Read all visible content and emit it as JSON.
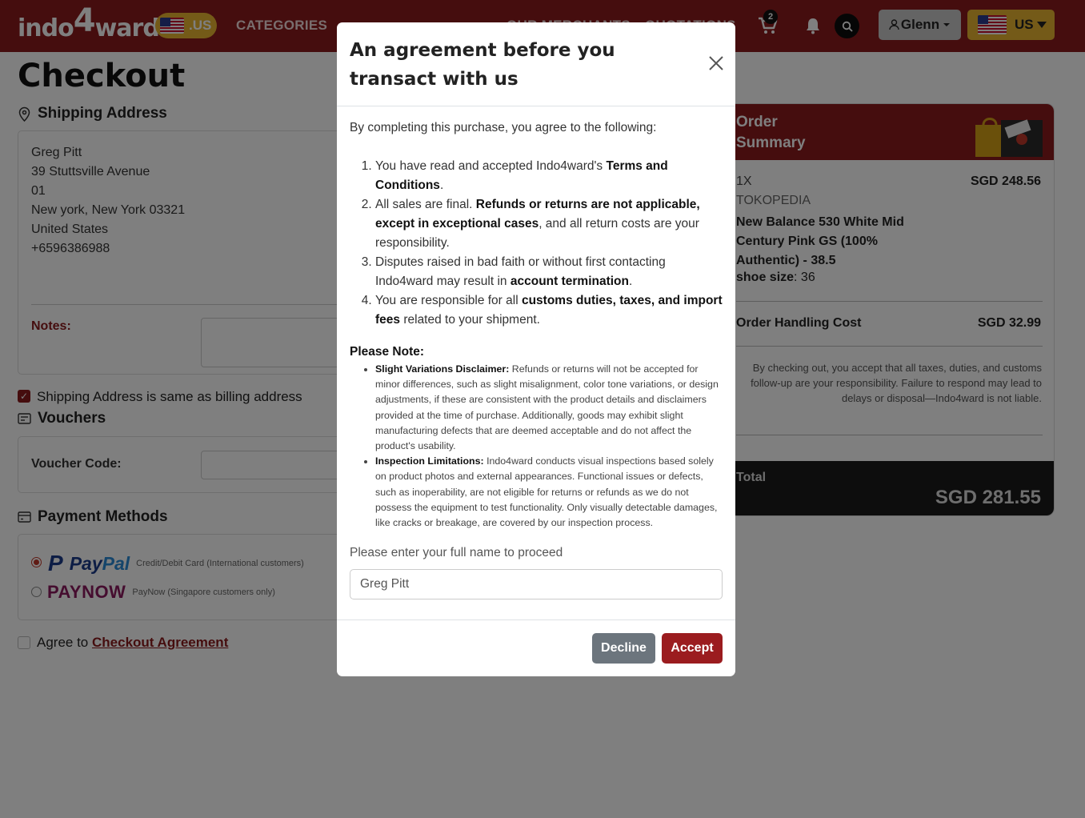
{
  "navbar": {
    "logo": "indo4ward",
    "region_badge": ".US",
    "links": [
      "CATEGORIES",
      "OUR MERCHANTS",
      "QUOTATIONS"
    ],
    "cart_count": "2",
    "user_label": "Glenn",
    "country_label": "US",
    "icons": [
      "cart-icon",
      "bell-icon",
      "search-icon",
      "user-icon",
      "caret-down-icon"
    ]
  },
  "page": {
    "title": "Checkout",
    "shipping": {
      "heading": "Shipping Address",
      "address_lines": [
        "Greg Pitt",
        "39 Stuttsville Avenue",
        "01",
        "New york, New York 03321",
        "United States",
        "+6596386988"
      ],
      "notes_label": "Notes:"
    },
    "same_billing_label": "Shipping Address is same as billing address",
    "vouchers": {
      "heading": "Vouchers",
      "code_label": "Voucher Code:"
    },
    "payment": {
      "heading": "Payment Methods",
      "paypal_desc": "Credit/Debit Card (International customers)",
      "paynow_name": "PAYNOW",
      "paynow_desc": "PayNow (Singapore customers only)"
    },
    "agree": {
      "prefix": "Agree to",
      "link": "Checkout Agreement"
    }
  },
  "summary": {
    "title": "Order Summary",
    "qty": "1X",
    "store": "TOKOPEDIA",
    "product_name": "New Balance 530 White Mid Century Pink GS (100% Authentic) - 38.5",
    "variant_label": "shoe size",
    "variant_value": ": 36",
    "item_price": "SGD 248.56",
    "handling_label": "Order Handling Cost",
    "handling_price": "SGD 32.99",
    "disclaimer": "By checking out, you accept that all taxes, duties, and customs follow-up are your responsibility. Failure to respond may lead to delays or disposal—Indo4ward is not liable.",
    "total_label": "Total",
    "total_value": "SGD 281.55"
  },
  "modal": {
    "title": "An agreement before you transact with us",
    "intro": "By completing this purchase, you agree to the following:",
    "terms": {
      "t1_a": "You have read and accepted Indo4ward's ",
      "t1_b": "Terms and Conditions",
      "t1_c": ".",
      "t2_a": "All sales are final. ",
      "t2_b": "Refunds or returns are not applicable, except in exceptional cases",
      "t2_c": ", and all return costs are your responsibility.",
      "t3_a": "Disputes raised in bad faith or without first contacting Indo4ward may result in ",
      "t3_b": "account termination",
      "t3_c": ".",
      "t4_a": "You are responsible for all ",
      "t4_b": "customs duties, taxes, and import fees",
      "t4_c": " related to your shipment."
    },
    "note_title": "Please Note:",
    "notes": {
      "n1_title": "Slight Variations Disclaimer:",
      "n1_text": " Refunds or returns will not be accepted for minor differences, such as slight misalignment, color tone variations, or design adjustments, if these are consistent with the product details and disclaimers provided at the time of purchase. Additionally, goods may exhibit slight manufacturing defects that are deemed acceptable and do not affect the product's usability.",
      "n2_title": "Inspection Limitations:",
      "n2_text": " Indo4ward conducts visual inspections based solely on product photos and external appearances. Functional issues or defects, such as inoperability, are not eligible for returns or refunds as we do not possess the equipment to test functionality. Only visually detectable damages, like cracks or breakage, are covered by our inspection process."
    },
    "name_prompt": "Please enter your full name to proceed",
    "name_value": "Greg Pitt",
    "decline_label": "Decline",
    "accept_label": "Accept"
  },
  "colors": {
    "brand": "#8b1a1d",
    "gold": "#e8b431",
    "decline": "#6c757d",
    "accept": "#9b1c1f"
  }
}
